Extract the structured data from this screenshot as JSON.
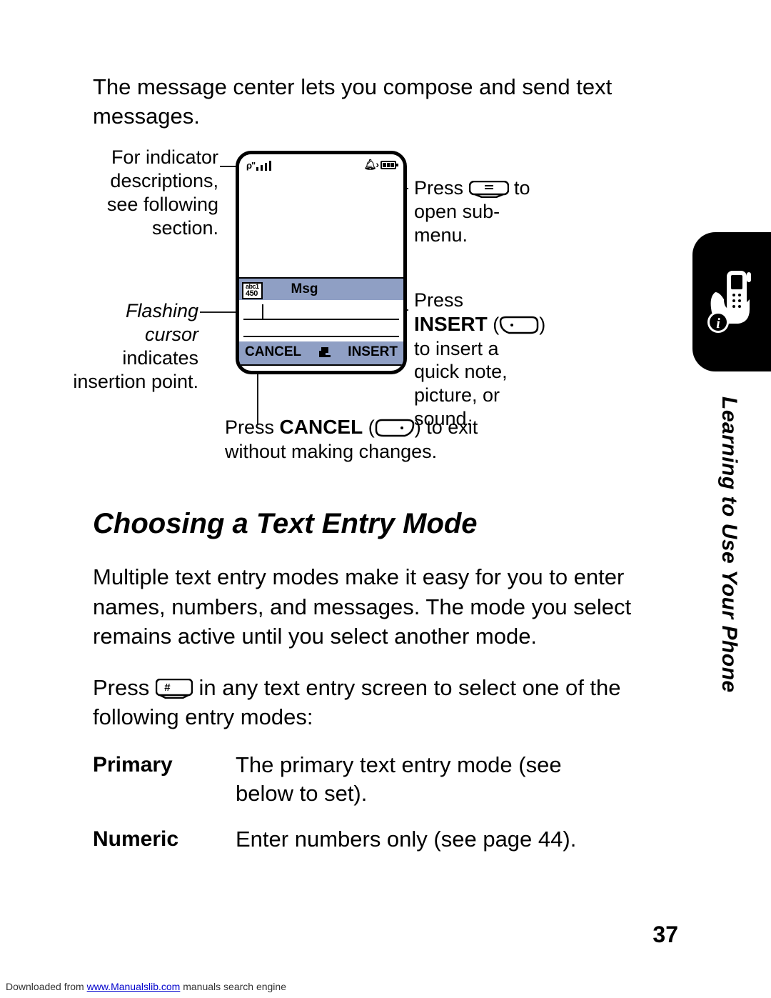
{
  "intro": "The message center lets you compose and send text messages.",
  "callouts": {
    "indicators_l1": "For indicator",
    "indicators_l2": "descriptions,",
    "indicators_l3": "see following",
    "indicators_l4": "section.",
    "cursor_l1": "Flashing",
    "cursor_l2": "cursor",
    "cursor_l3": "indicates",
    "cursor_l4": "insertion point.",
    "menu_l1_pre": "Press ",
    "menu_l1_post": " to",
    "menu_l2": "open sub-",
    "menu_l3": "menu.",
    "insert_l1": "Press",
    "insert_bold": "INSERT",
    "insert_paren_open": " (",
    "insert_paren_close": ")",
    "insert_l2": "to insert a",
    "insert_l3": "quick note,",
    "insert_l4": "picture, or",
    "insert_l5": "sound.",
    "cancel_pre": "Press ",
    "cancel_bold": "CANCEL",
    "cancel_mid": " (",
    "cancel_post": ") to exit",
    "cancel_l2": "without making changes."
  },
  "phone": {
    "entry_mode1": "abc1",
    "counter": "450",
    "title": "Msg",
    "soft_left": "CANCEL",
    "soft_right": "INSERT"
  },
  "heading": "Choosing a Text Entry Mode",
  "body1": "Multiple text entry modes make it easy for you to enter names, numbers, and messages. The mode you select remains active until you select another mode.",
  "body2_pre": "Press ",
  "body2_post": " in any text entry screen to select one of the following entry modes:",
  "modes": {
    "primary_k": "Primary",
    "primary_v": "The primary text entry mode (see below to set).",
    "numeric_k": "Numeric",
    "numeric_v": "Enter numbers only (see page 44)."
  },
  "side_title": "Learning to Use Your Phone",
  "page_num": "37",
  "footer_pre": "Downloaded from ",
  "footer_link": "www.Manualslib.com",
  "footer_post": " manuals search engine"
}
